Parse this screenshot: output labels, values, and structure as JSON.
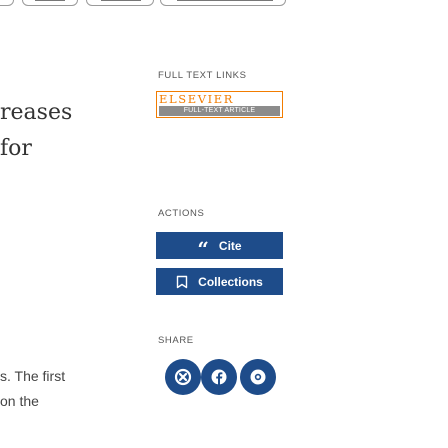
{
  "article": {
    "fragments": [
      "reases",
      "for",
      "s. The first",
      "on the"
    ]
  },
  "sidebar": {
    "full_text_links_heading": "FULL TEXT LINKS",
    "elsevier_badge": {
      "wordmark": "ELSEVIER",
      "subtitle": "FULL-TEXT ARTICLE"
    },
    "actions_heading": "ACTIONS",
    "actions": [
      {
        "label": "Cite",
        "icon": "quote-icon"
      },
      {
        "label": "Collections",
        "icon": "bookmark-icon"
      }
    ],
    "share_heading": "SHARE",
    "share": [
      {
        "icon": "email-icon"
      },
      {
        "icon": "facebook-icon"
      },
      {
        "icon": "twitter-icon"
      }
    ]
  },
  "colors": {
    "accent": "#1e4c8a",
    "elsevier_orange": "#f27c00",
    "elsevier_gray": "#8c8c8c"
  }
}
